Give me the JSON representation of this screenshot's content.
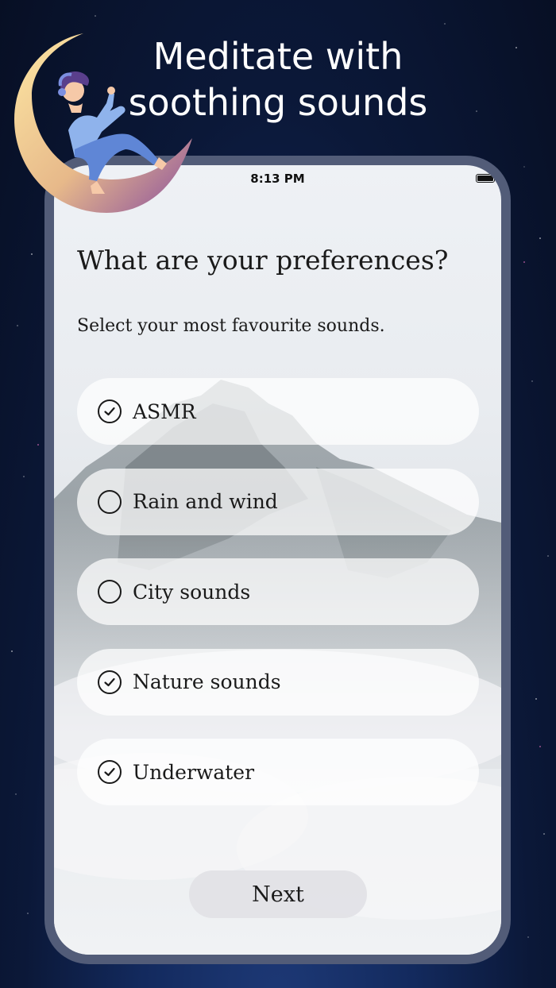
{
  "headline": {
    "line1": "Meditate with",
    "line2": "soothing sounds"
  },
  "status": {
    "time": "8:13 PM"
  },
  "screen": {
    "title": "What are your preferences?",
    "subtitle": "Select your most favourite sounds."
  },
  "options": [
    {
      "label": "ASMR",
      "checked": true
    },
    {
      "label": "Rain and wind",
      "checked": false
    },
    {
      "label": "City sounds",
      "checked": false
    },
    {
      "label": "Nature sounds",
      "checked": true
    },
    {
      "label": "Underwater",
      "checked": true
    }
  ],
  "next_label": "Next",
  "colors": {
    "accent_purple": "#8a5ca8",
    "moon_yellow": "#f6d88f",
    "background_navy": "#0b1838"
  },
  "icons": {
    "checked": "check-circle-icon",
    "unchecked": "empty-circle-icon",
    "battery": "battery-icon"
  }
}
